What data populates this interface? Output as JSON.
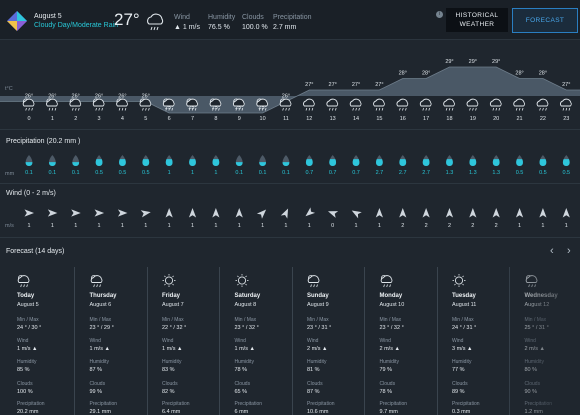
{
  "header": {
    "date": "August 5",
    "condition": "Cloudy Day/Moderate Rain",
    "temperature": "27°",
    "stats": [
      {
        "label": "Wind",
        "value": "▲ 1 m/s"
      },
      {
        "label": "Humidity",
        "value": "76.5 %"
      },
      {
        "label": "Clouds",
        "value": "100.0 %"
      },
      {
        "label": "Precipitation",
        "value": "2.7 mm"
      }
    ],
    "info": "i",
    "historical_label": "HISTORICAL WEATHER",
    "forecast_label": "FORECAST"
  },
  "hourly": {
    "unit": "t°C",
    "hours": [
      "0",
      "1",
      "2",
      "3",
      "4",
      "5",
      "6",
      "7",
      "8",
      "9",
      "10",
      "11",
      "12",
      "13",
      "14",
      "15",
      "16",
      "17",
      "18",
      "19",
      "20",
      "21",
      "22",
      "23"
    ],
    "temps": [
      "26°",
      "26°",
      "26°",
      "26°",
      "26°",
      "26°",
      "25°",
      "25°",
      "25°",
      "25°",
      "25°",
      "26°",
      "27°",
      "27°",
      "27°",
      "27°",
      "28°",
      "28°",
      "29°",
      "29°",
      "29°",
      "28°",
      "28°",
      "27°"
    ],
    "icons": [
      "cloud-sun-rain",
      "cloud-sun-rain",
      "cloud-sun-rain",
      "cloud-sun-rain",
      "cloud-sun-rain",
      "cloud-sun-rain",
      "cloud-sun-rain",
      "cloud-sun-rain",
      "cloud-sun-rain",
      "cloud-sun-rain",
      "cloud-sun-rain",
      "cloud-sun-rain",
      "cloud-rain",
      "cloud-rain",
      "cloud-rain",
      "cloud-rain",
      "cloud-rain",
      "cloud-rain",
      "cloud-rain",
      "cloud-rain",
      "cloud-rain",
      "cloud-rain",
      "cloud-rain",
      "cloud-rain"
    ]
  },
  "chart_data": {
    "type": "area",
    "title": "",
    "xlabel": "",
    "ylabel": "t°C",
    "x": [
      0,
      1,
      2,
      3,
      4,
      5,
      6,
      7,
      8,
      9,
      10,
      11,
      12,
      13,
      14,
      15,
      16,
      17,
      18,
      19,
      20,
      21,
      22,
      23
    ],
    "values": [
      26,
      26,
      26,
      26,
      26,
      26,
      25,
      25,
      25,
      25,
      25,
      26,
      27,
      27,
      27,
      27,
      28,
      28,
      29,
      29,
      29,
      28,
      28,
      27
    ],
    "ylim": [
      23,
      30
    ]
  },
  "precipitation": {
    "title": "Precipitation (20.2 mm )",
    "unit": "mm",
    "values": [
      "0.1",
      "0.1",
      "0.1",
      "0.5",
      "0.5",
      "0.5",
      "1",
      "1",
      "1",
      "0.1",
      "0.1",
      "0.1",
      "0.7",
      "0.7",
      "0.7",
      "2.7",
      "2.7",
      "2.7",
      "1.3",
      "1.3",
      "1.3",
      "0.5",
      "0.5",
      "0.5"
    ],
    "fill": [
      0.1,
      0.1,
      0.1,
      0.5,
      0.5,
      0.5,
      0.5,
      0.5,
      0.5,
      0.1,
      0.1,
      0.1,
      0.5,
      0.5,
      0.5,
      0.5,
      0.5,
      0.5,
      0.5,
      0.5,
      0.5,
      0.5,
      0.5,
      0.5
    ],
    "color": "#2ec6dc"
  },
  "wind": {
    "title": "Wind (0 - 2 m/s)",
    "unit": "m/s",
    "values": [
      "1",
      "1",
      "1",
      "1",
      "1",
      "1",
      "1",
      "1",
      "1",
      "1",
      "1",
      "1",
      "1",
      "0",
      "1",
      "1",
      "2",
      "2",
      "2",
      "2",
      "2",
      "1",
      "1",
      "1"
    ],
    "direction_deg": [
      90,
      90,
      90,
      90,
      90,
      80,
      0,
      0,
      0,
      0,
      45,
      25,
      230,
      290,
      300,
      0,
      0,
      0,
      0,
      0,
      0,
      0,
      0,
      0
    ]
  },
  "forecast": {
    "title": "Forecast (14 days)",
    "prev": "‹",
    "next": "›",
    "labels": {
      "minmax": "Min / Max",
      "wind": "Wind",
      "humidity": "Humidity",
      "clouds": "Clouds",
      "precip": "Precipitation"
    },
    "days": [
      {
        "day": "Today",
        "date": "August 5",
        "minmax": "24 ° / 30 °",
        "wind": "1 m/s ▲",
        "humidity": "85 %",
        "clouds": "100 %",
        "precip": "20.2 mm",
        "icon": "cloud-sun-rain"
      },
      {
        "day": "Thursday",
        "date": "August 6",
        "minmax": "23 ° / 29 °",
        "wind": "1 m/s ▲",
        "humidity": "87 %",
        "clouds": "99 %",
        "precip": "29.1 mm",
        "icon": "cloud-sun-rain"
      },
      {
        "day": "Friday",
        "date": "August 7",
        "minmax": "22 ° / 32 °",
        "wind": "1 m/s ▲",
        "humidity": "83 %",
        "clouds": "82 %",
        "precip": "6.4 mm",
        "icon": "sun"
      },
      {
        "day": "Saturday",
        "date": "August 8",
        "minmax": "23 ° / 32 °",
        "wind": "1 m/s ▲",
        "humidity": "78 %",
        "clouds": "65 %",
        "precip": "6 mm",
        "icon": "sun"
      },
      {
        "day": "Sunday",
        "date": "August 9",
        "minmax": "23 ° / 31 °",
        "wind": "2 m/s ▲",
        "humidity": "81 %",
        "clouds": "87 %",
        "precip": "10.6 mm",
        "icon": "cloud-sun-rain"
      },
      {
        "day": "Monday",
        "date": "August 10",
        "minmax": "23 ° / 32 °",
        "wind": "2 m/s ▲",
        "humidity": "79 %",
        "clouds": "78 %",
        "precip": "9.7 mm",
        "icon": "cloud-sun-rain"
      },
      {
        "day": "Tuesday",
        "date": "August 11",
        "minmax": "24 ° / 31 °",
        "wind": "3 m/s ▲",
        "humidity": "77 %",
        "clouds": "89 %",
        "precip": "0.3 mm",
        "icon": "sun"
      },
      {
        "day": "Wednesday",
        "date": "August 12",
        "minmax": "25 ° / 31 °",
        "wind": "2 m/s ▲",
        "humidity": "80 %",
        "clouds": "90 %",
        "precip": "1.2 mm",
        "icon": "cloud-sun-rain"
      }
    ]
  },
  "colors": {
    "accent": "#28c8d8",
    "forecast_border": "#2a7ec1",
    "forecast_text": "#48a6ea"
  }
}
